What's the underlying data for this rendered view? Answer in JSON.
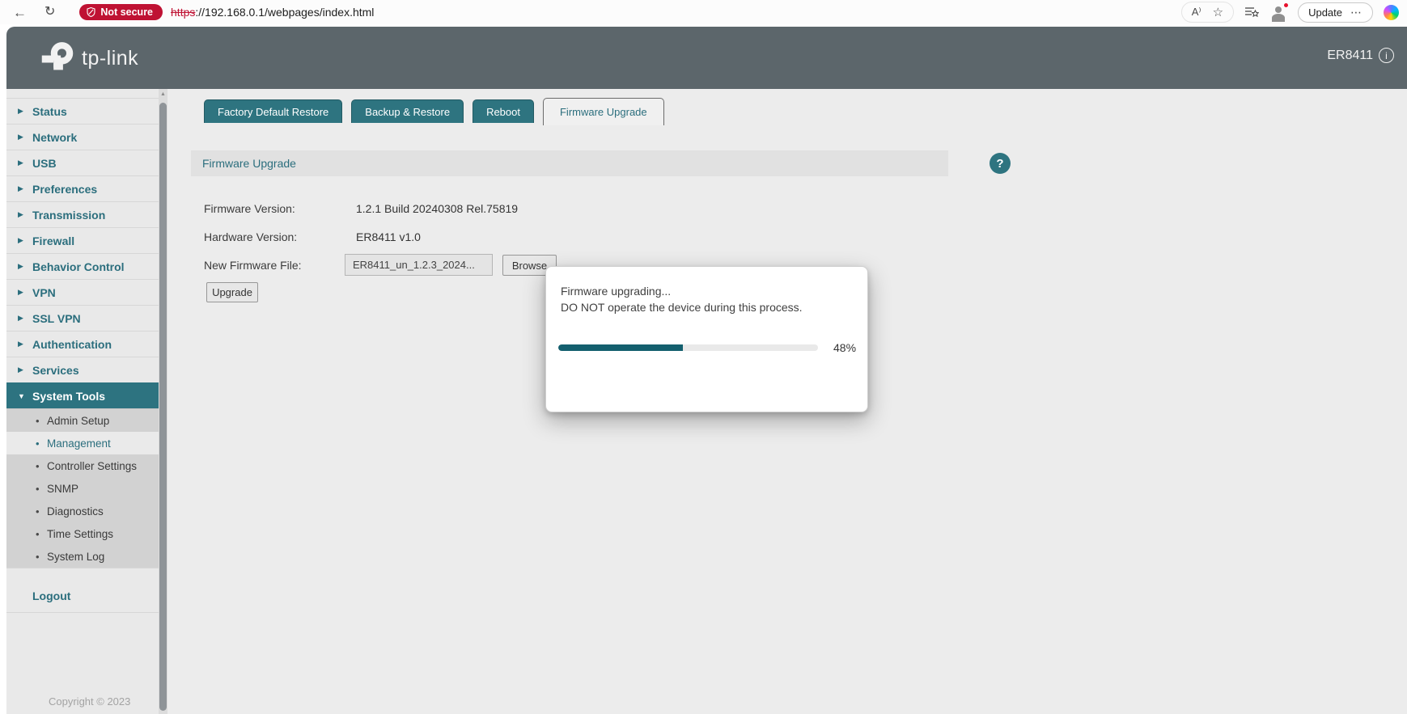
{
  "browser": {
    "badge": "Not secure",
    "url_scheme": "https",
    "url_rest": "://192.168.0.1/webpages/index.html",
    "update_button": "Update"
  },
  "icons": {
    "back": "←",
    "refresh": "↻",
    "read_aloud": "A⁾",
    "favorite_star": "☆",
    "overflow": "⋯",
    "info": "i",
    "help": "?",
    "menu_collapsed": "▶",
    "menu_expanded": "▼",
    "bullet": "•",
    "scroll_up": "▲"
  },
  "header": {
    "brand": "tp-link",
    "model": "ER8411"
  },
  "sidebar": {
    "items": [
      {
        "label": "Status"
      },
      {
        "label": "Network"
      },
      {
        "label": "USB"
      },
      {
        "label": "Preferences"
      },
      {
        "label": "Transmission"
      },
      {
        "label": "Firewall"
      },
      {
        "label": "Behavior Control"
      },
      {
        "label": "VPN"
      },
      {
        "label": "SSL VPN"
      },
      {
        "label": "Authentication"
      },
      {
        "label": "Services"
      },
      {
        "label": "System Tools",
        "expanded": true,
        "selected": true
      }
    ],
    "submenu": [
      {
        "label": "Admin Setup"
      },
      {
        "label": "Management",
        "active": true
      },
      {
        "label": "Controller Settings"
      },
      {
        "label": "SNMP"
      },
      {
        "label": "Diagnostics"
      },
      {
        "label": "Time Settings"
      },
      {
        "label": "System Log"
      }
    ],
    "logout": "Logout",
    "copyright": "Copyright © 2023"
  },
  "tabs": [
    {
      "label": "Factory Default Restore",
      "active": false
    },
    {
      "label": "Backup & Restore",
      "active": false
    },
    {
      "label": "Reboot",
      "active": false
    },
    {
      "label": "Firmware Upgrade",
      "active": true
    }
  ],
  "content": {
    "section_title": "Firmware Upgrade",
    "firmware_version_label": "Firmware Version:",
    "firmware_version_value": "1.2.1 Build 20240308 Rel.75819",
    "hardware_version_label": "Hardware Version:",
    "hardware_version_value": "ER8411 v1.0",
    "new_firmware_label": "New Firmware File:",
    "new_firmware_value": "ER8411_un_1.2.3_2024...",
    "browse_button": "Browse",
    "upgrade_button": "Upgrade"
  },
  "modal": {
    "line1": "Firmware upgrading...",
    "line2": "DO NOT operate the device during this process.",
    "progress_percent": 48,
    "progress_label": "48%"
  },
  "colors": {
    "header_bg": "#5c666b",
    "teal": "#2e7480",
    "teal_text": "#2b6e7d",
    "progress_fill": "#135f6e",
    "badge_red": "#bf1233",
    "sidebar_bg": "#e9e9e9",
    "submenu_bg": "#d2d2d2",
    "content_bg": "#ececec"
  }
}
